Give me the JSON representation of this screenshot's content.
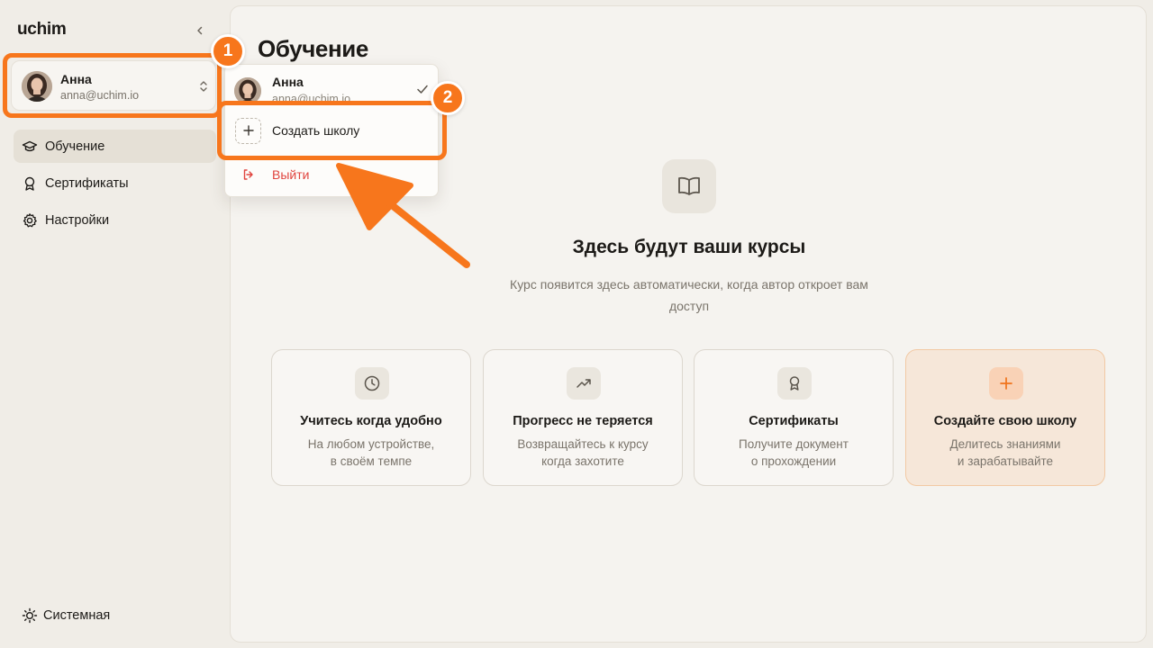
{
  "app": {
    "logo": "uchim"
  },
  "sidebar": {
    "user": {
      "name": "Анна",
      "email": "anna@uchim.io"
    },
    "items": [
      {
        "label": "Обучение",
        "icon": "graduation-cap-icon",
        "active": true
      },
      {
        "label": "Сертификаты",
        "icon": "award-icon",
        "active": false
      },
      {
        "label": "Настройки",
        "icon": "gear-icon",
        "active": false
      }
    ],
    "theme_label": "Системная"
  },
  "main": {
    "title": "Обучение",
    "empty": {
      "icon": "book-open-icon",
      "title": "Здесь будут ваши курсы",
      "description": "Курс появится здесь автоматически, когда автор откроет вам доступ"
    },
    "features": [
      {
        "icon": "clock-icon",
        "title": "Учитесь когда удобно",
        "line1": "На любом устройстве,",
        "line2": "в своём темпе"
      },
      {
        "icon": "trending-up-icon",
        "title": "Прогресс не теряется",
        "line1": "Возвращайтесь к курсу",
        "line2": "когда захотите"
      },
      {
        "icon": "award-icon",
        "title": "Сертификаты",
        "line1": "Получите документ",
        "line2": "о прохождении"
      },
      {
        "icon": "plus-icon",
        "title": "Создайте свою школу",
        "line1": "Делитесь знаниями",
        "line2": "и зарабатывайте"
      }
    ]
  },
  "dropdown": {
    "user": {
      "name": "Анна",
      "email": "anna@uchim.io",
      "selected": true
    },
    "create_label": "Создать школу",
    "logout_label": "Выйти"
  },
  "overlay": {
    "steps": [
      "1",
      "2"
    ],
    "accent_color": "#f7761c"
  },
  "colors": {
    "accent": "#f7761c",
    "danger": "#e0443e",
    "sidebar_bg": "#f0ede7",
    "panel_bg": "#f5f3ef"
  }
}
